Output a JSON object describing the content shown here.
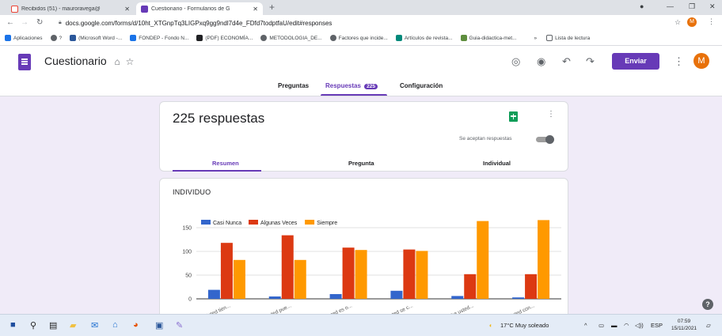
{
  "browser": {
    "tabs": [
      {
        "title": "Recibidos (51) - mauroravega@",
        "favicon_color": "#ea4335"
      },
      {
        "title": "Cuestionario - Formularios de G",
        "favicon_color": "#673ab7"
      }
    ],
    "url": "docs.google.com/forms/d/10ht_XTGnpTq3LIGPxq9gg9ndl7d4e_FDfd7todptfaU/edit#responses",
    "bookmarks": [
      {
        "label": "Aplicaciones",
        "color": "#5f6368"
      },
      {
        "label": "?",
        "color": "#5f6368"
      },
      {
        "label": "(Microsoft Word -...",
        "color": "#2b579a"
      },
      {
        "label": "FONDEP - Fondo N...",
        "color": "#1a73e8"
      },
      {
        "label": "(PDF) ECONOMÍA...",
        "color": "#202124"
      },
      {
        "label": "METODOLOGIA_DE...",
        "color": "#5f6368"
      },
      {
        "label": "Factores que incide...",
        "color": "#5f6368"
      },
      {
        "label": "Artículos de revista...",
        "color": "#00897b"
      },
      {
        "label": "Guia-didactica-met...",
        "color": "#5e8e3e"
      }
    ],
    "bookmarks_more": "»",
    "reading_list": "Lista de lectura",
    "profile_initial": "M"
  },
  "header": {
    "form_title": "Cuestionario",
    "send_label": "Enviar",
    "avatar_initial": "M"
  },
  "main_tabs": {
    "questions": "Preguntas",
    "responses": "Respuestas",
    "responses_count": "225",
    "settings": "Configuración"
  },
  "summary_card": {
    "title": "225 respuestas",
    "accepting_label": "Se aceptan respuestas",
    "accepting": true,
    "subtabs": {
      "summary": "Resumen",
      "question": "Pregunta",
      "individual": "Individual"
    }
  },
  "question_card": {
    "title": "INDIVIDUO"
  },
  "chart_data": {
    "type": "bar",
    "categories": [
      "Usted tien...",
      "Usted pue...",
      "Usted es o...",
      "Usted se c...",
      "Sabe usted...",
      "Usted con..."
    ],
    "series": [
      {
        "name": "Casi Nunca",
        "color": "#3366cc",
        "values": [
          19,
          5,
          10,
          17,
          6,
          3
        ]
      },
      {
        "name": "Algunas Veces",
        "color": "#dc3912",
        "values": [
          118,
          134,
          108,
          104,
          52,
          52
        ]
      },
      {
        "name": "Siempre",
        "color": "#ff9900",
        "values": [
          82,
          82,
          103,
          101,
          164,
          166
        ]
      }
    ],
    "yticks": [
      0,
      50,
      100,
      150
    ],
    "ylim": [
      0,
      175
    ],
    "legend_position": "top",
    "grid": true
  },
  "taskbar": {
    "weather": "17°C  Muy soleado",
    "language": "ESP",
    "time": "07:59",
    "date": "15/11/2021"
  }
}
